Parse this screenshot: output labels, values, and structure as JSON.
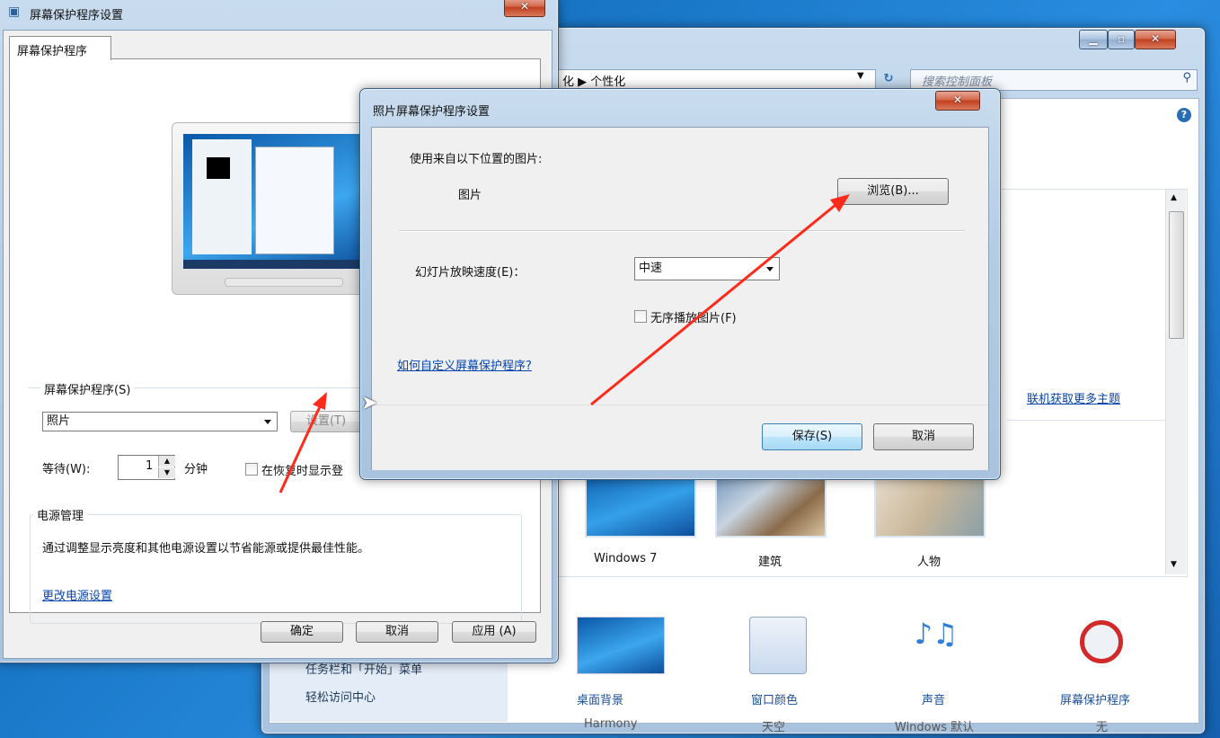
{
  "personalization": {
    "breadcrumb": "化  ▶  个性化",
    "search_placeholder": "搜索控制面板",
    "get_more_themes": "联机获取更多主题",
    "themes": [
      {
        "label": "Windows 7"
      },
      {
        "label": "建筑"
      },
      {
        "label": "人物"
      }
    ],
    "left_items": [
      "任务栏和「开始」菜单",
      "轻松访问中心"
    ],
    "bottom_items": [
      {
        "label": "桌面背景",
        "sub": "Harmony",
        "icon": "desktop-background-icon"
      },
      {
        "label": "窗口颜色",
        "sub": "天空",
        "icon": "window-color-icon"
      },
      {
        "label": "声音",
        "sub": "Windows 默认",
        "icon": "sound-icon"
      },
      {
        "label": "屏幕保护程序",
        "sub": "无",
        "icon": "screensaver-icon"
      }
    ]
  },
  "screensaver_window": {
    "title": "屏幕保护程序设置",
    "tab": "屏幕保护程序",
    "group_label": "屏幕保护程序(S)",
    "selected_saver": "照片",
    "settings_button": "设置(T)",
    "wait_label": "等待(W):",
    "wait_value": "1",
    "minutes_label": "分钟",
    "resume_label": "在恢复时显示登",
    "power_group": "电源管理",
    "power_text": "通过调整显示亮度和其他电源设置以节省能源或提供最佳性能。",
    "power_link": "更改电源设置",
    "ok": "确定",
    "cancel": "取消",
    "apply": "应用 (A)"
  },
  "photo_dialog": {
    "title": "照片屏幕保护程序设置",
    "use_from_label": "使用来自以下位置的图片:",
    "pictures_label": "图片",
    "browse_button": "浏览(B)...",
    "speed_label": "幻灯片放映速度(E)：",
    "speed_value": "中速",
    "shuffle_label": "无序播放图片(F)",
    "help_link": "如何自定义屏幕保护程序?",
    "save_button": "保存(S)",
    "cancel_button": "取消"
  },
  "colors": {
    "annotation_arrow": "#ff2a1a",
    "link": "#0645ad"
  }
}
